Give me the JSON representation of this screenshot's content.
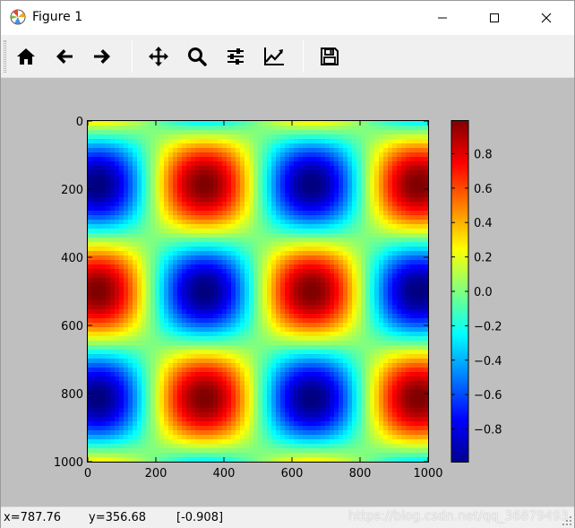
{
  "window": {
    "title": "Figure 1"
  },
  "window_controls": {
    "minimize": "minimize-icon",
    "maximize": "maximize-icon",
    "close": "close-icon"
  },
  "toolbar": {
    "buttons": [
      {
        "name": "home",
        "icon": "home-icon"
      },
      {
        "name": "back",
        "icon": "arrow-left-icon"
      },
      {
        "name": "forward",
        "icon": "arrow-right-icon"
      },
      {
        "name": "pan",
        "icon": "move-icon"
      },
      {
        "name": "zoom",
        "icon": "magnifier-icon"
      },
      {
        "name": "subplots",
        "icon": "sliders-icon"
      },
      {
        "name": "edit-axes",
        "icon": "line-chart-icon"
      },
      {
        "name": "save",
        "icon": "floppy-disk-icon"
      }
    ]
  },
  "status": {
    "x_readout": "x=787.76",
    "y_readout": "y=356.68",
    "value_readout": "[-0.908]",
    "watermark": "https://blog.csdn.net/qq_36879493"
  },
  "chart_data": {
    "type": "heatmap",
    "function": "sin(x) * cos(y)",
    "x_range": [
      0,
      1000
    ],
    "y_range": [
      0,
      1000
    ],
    "y_inverted": true,
    "x_ticks": [
      "0",
      "200",
      "400",
      "600",
      "800",
      "1000"
    ],
    "y_ticks": [
      "0",
      "200",
      "400",
      "600",
      "800",
      "1000"
    ],
    "colormap": "jet",
    "color_range": [
      -0.99,
      0.99
    ],
    "colorbar_ticks": [
      "0.8",
      "0.6",
      "0.4",
      "0.2",
      "0.0",
      "−0.2",
      "−0.4",
      "−0.6",
      "−0.8"
    ],
    "colorbar_values": [
      0.8,
      0.6,
      0.4,
      0.2,
      0.0,
      -0.2,
      -0.4,
      -0.6,
      -0.8
    ]
  }
}
